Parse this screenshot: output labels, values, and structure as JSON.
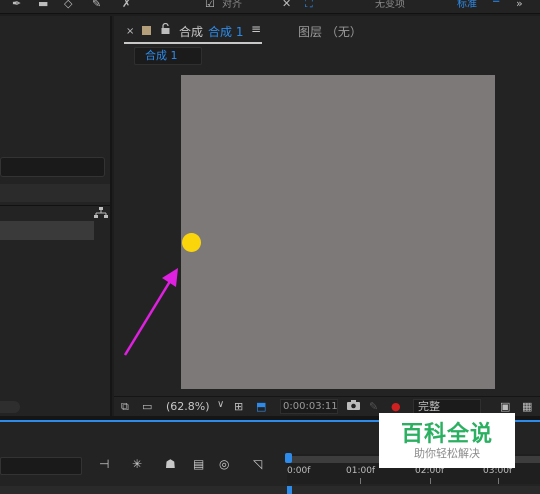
{
  "top_toolbar": {
    "snap_label": "对齐",
    "workspace_label": "无变项",
    "standard_label": "标准",
    "menu_glyph": "≡"
  },
  "composition_panel": {
    "close_glyph": "×",
    "tab_prefix": "合成",
    "tab_name": "合成 1",
    "tab_menu_glyph": "≡",
    "layer_panel_label": "图层 （无）",
    "breadcrumb": "合成 1",
    "swatch_color": "#b59e7a"
  },
  "viewer": {
    "canvas_color": "#7e7979",
    "sun_color": "#fbd50c",
    "arrow_color": "#e020e0"
  },
  "viewer_bottombar": {
    "zoom_level": "(62.8%)",
    "zoom_chevron": "∨",
    "timecode": "0:00:03:11",
    "resolution": "完整"
  },
  "timeline": {
    "ticks": [
      "0:00f",
      "01:00f",
      "02:00f",
      "03:00f"
    ],
    "accent_color": "#2d8ceb"
  },
  "watermark": {
    "title": "百科全说",
    "subtitle": "助你轻松解决"
  },
  "icons": {
    "lock": "🔓",
    "camera": "📷"
  }
}
